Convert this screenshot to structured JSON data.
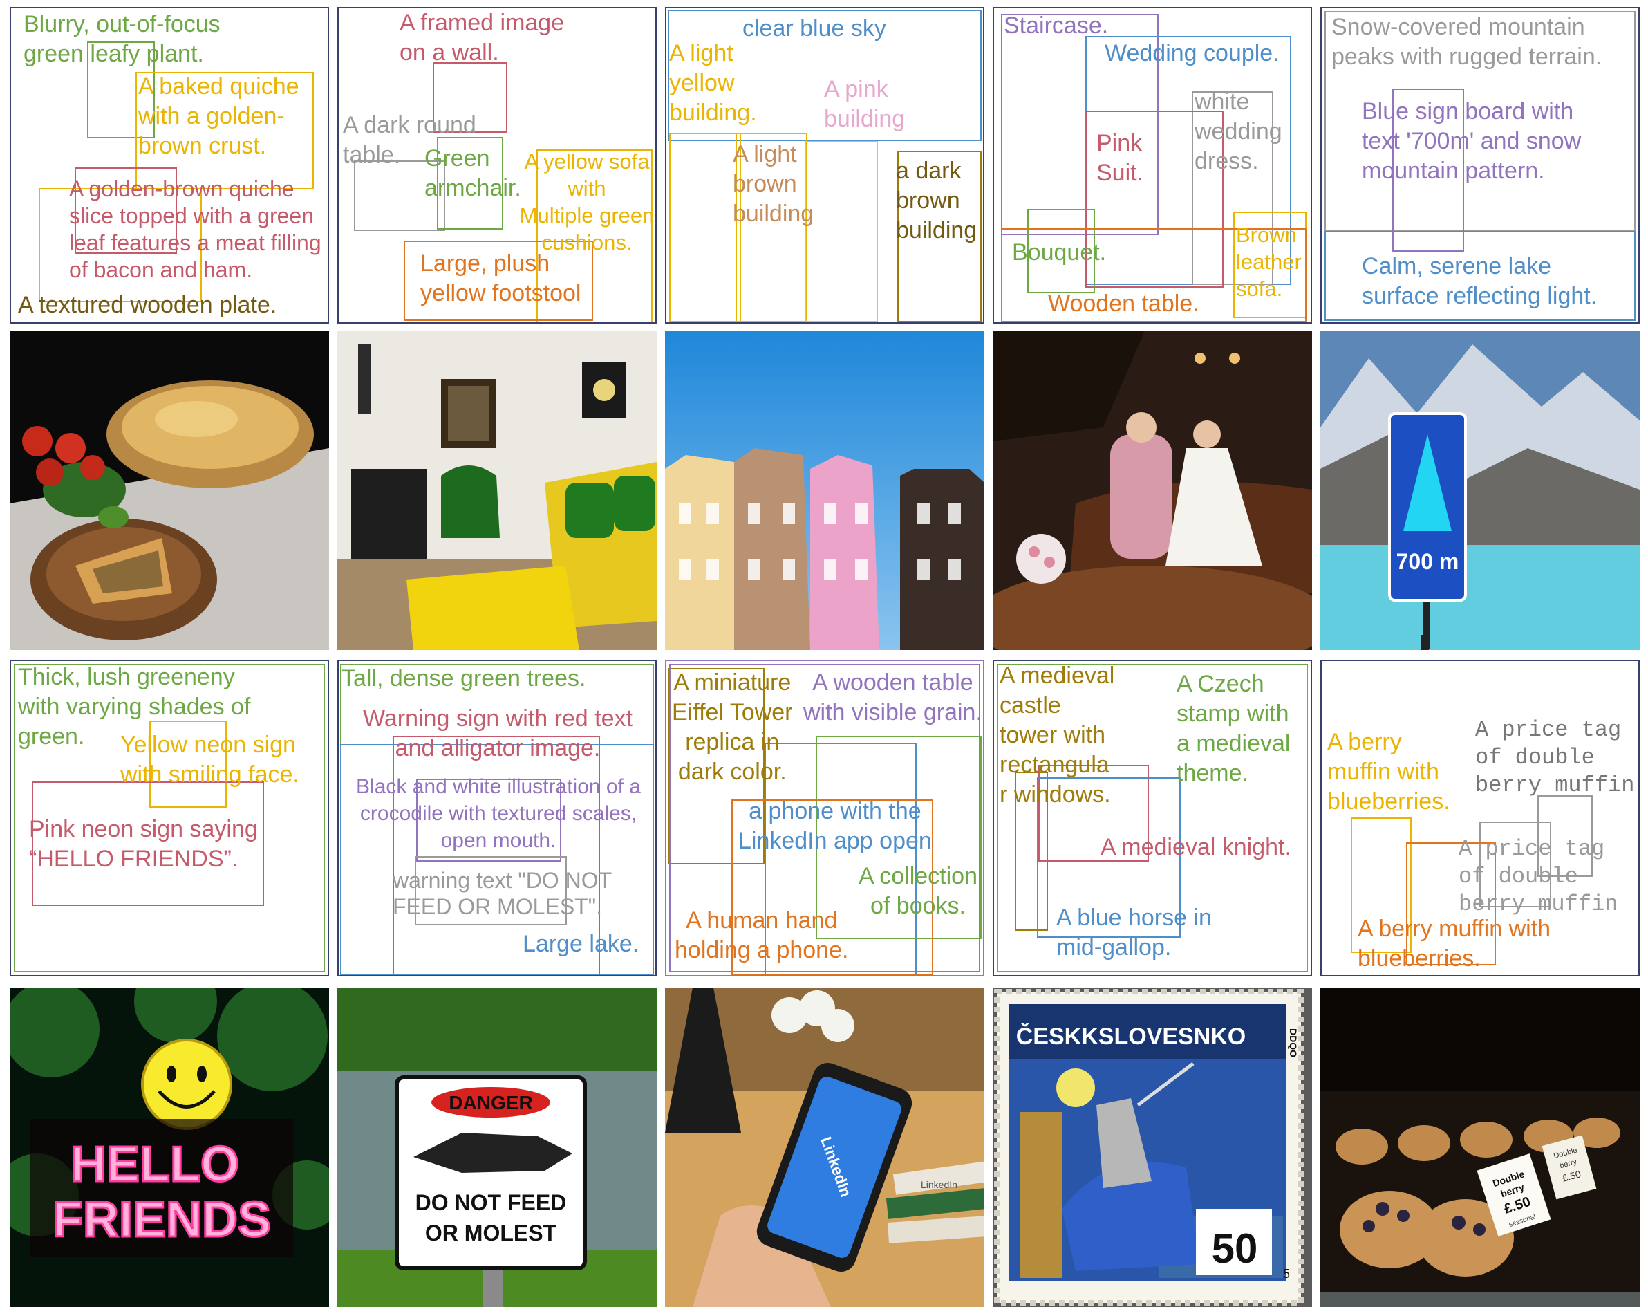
{
  "colors": {
    "green": "#6ea845",
    "yellow": "#eab400",
    "red": "#c55a6b",
    "gray": "#9a9a9a",
    "blue": "#4f8ec9",
    "olive": "#9d7c0a",
    "purple": "#9273bd",
    "orange": "#e0741f",
    "pink": "#e7a8cf",
    "brown": "#735a12",
    "panel_border": "#38406e"
  },
  "panels": {
    "p1": {
      "labels": [
        "Blurry, out-of-focus\ngreen leafy plant.",
        "A baked quiche\nwith a golden-\nbrown crust.",
        "A golden-brown quiche\nslice topped with a green\nleaf features a meat filling\nof bacon and ham.",
        "A textured wooden plate."
      ]
    },
    "p2": {
      "labels": [
        "A framed image\non a wall.",
        "A dark round\ntable.",
        "Green\narmchair.",
        "A yellow sofa\nwith\nMultiple green\ncushions.",
        "Large, plush\nyellow footstool"
      ]
    },
    "p3": {
      "labels": [
        "clear blue sky",
        "A light\nyellow\nbuilding.",
        "A pink\nbuilding",
        "A light\nbrown\nbuilding",
        "a dark\nbrown\nbuilding"
      ]
    },
    "p4": {
      "labels": [
        "Staircase.",
        "Wedding couple.",
        "white\nwedding\ndress.",
        "Pink\nSuit.",
        "Bouquet.",
        "Brown\nleather\nsofa.",
        "Wooden table."
      ]
    },
    "p5": {
      "labels": [
        "Snow-covered mountain\npeaks with rugged terrain.",
        "Blue sign board with\ntext '700m' and snow\nmountain pattern.",
        "Calm, serene lake\nsurface reflecting light."
      ]
    },
    "p6": {
      "labels": [
        "Thick, lush greeneny\nwith varying shades of\ngreen.",
        "Yellow neon sign\nwith smiling face.",
        "Pink neon sign saying\n“HELLO FRIENDS”."
      ]
    },
    "p7": {
      "labels": [
        "Tall, dense green trees.",
        "Warning sign with red text\nand alligator image.",
        "Black and white illustration of a\ncrocodile with textured scales,\nopen mouth.",
        "warning text \"DO NOT\nFEED OR MOLEST\".",
        "Large lake."
      ]
    },
    "p8": {
      "labels": [
        "A miniature\nEiffel Tower\nreplica in\ndark color.",
        "A wooden table\nwith visible grain.",
        "a phone with the\nLinkedIn app open",
        "A collection\nof books.",
        "A human hand\nholding a phone."
      ]
    },
    "p9": {
      "labels": [
        "A medieval\ncastle\ntower with\nrectangula\nr windows.",
        "A Czech\nstamp with\na medieval\ntheme.",
        "A medieval knight.",
        "A blue horse in\nmid-gallop."
      ]
    },
    "p10": {
      "labels": [
        "A berry\nmuffin with\nblueberries.",
        "A price tag\nof double\nberry muffin",
        "A price tag\nof double\nberry muffin",
        "A berry muffin with\nblueberries."
      ]
    }
  },
  "photos": {
    "i6": {
      "line1": "HELLO",
      "line2": "FRIENDS"
    },
    "i7": {
      "header": "DANGER",
      "line1": "DO NOT FEED",
      "line2": "OR MOLEST"
    },
    "i8": {
      "app": "LinkedIn",
      "book_spine": "LinkedIn"
    },
    "i9": {
      "country": "ČESKKSLOVESNKO",
      "value": "50",
      "corner": "5",
      "side": "DDQO"
    },
    "i5": {
      "sign": "700 m"
    },
    "i10": {
      "tag1": [
        "Double",
        "berry",
        "£.50"
      ],
      "tag2": [
        "Double",
        "berry",
        "£.50"
      ],
      "tag1_small": "seasonal"
    }
  }
}
